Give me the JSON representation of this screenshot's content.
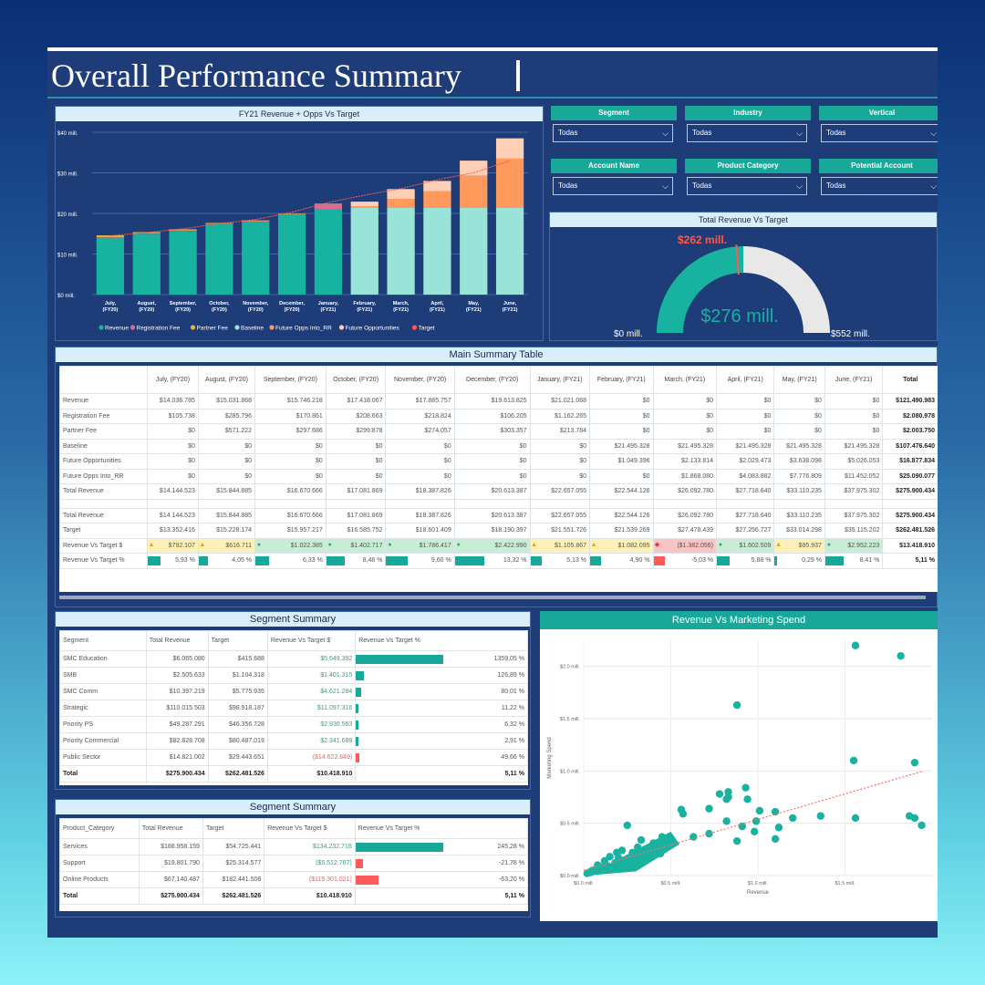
{
  "page": {
    "title": "Overall Performance Summary"
  },
  "colors": {
    "revenue": "#17b2a0",
    "baseline": "#9ae3d8",
    "future_opps_into_rr": "#ff9a5c",
    "future_opportunities": "#ffcfb5",
    "registration_fee": "#d86b9a",
    "partner_fee": "#e5b233",
    "target": "#ff5a4a",
    "accent": "#17a89a",
    "negative": "#ff5a5a"
  },
  "revenue_chart": {
    "title": "FY21 Revenue + Opps Vs Target",
    "y_ticks": [
      "$0 mill.",
      "$10 mill.",
      "$20 mill.",
      "$30 mill.",
      "$40 mill."
    ],
    "legend": [
      "Revenue",
      "Registration Fee",
      "Partner Fee",
      "Baseline",
      "Future Opps Into_RR",
      "Future Opportunities",
      "Target"
    ]
  },
  "chart_data": [
    {
      "type": "bar",
      "title": "FY21 Revenue + Opps Vs Target",
      "categories": [
        "July, (FY20)",
        "August, (FY20)",
        "September, (FY20)",
        "October, (FY20)",
        "November, (FY20)",
        "December, (FY20)",
        "January, (FY21)",
        "February, (FY21)",
        "March, (FY21)",
        "April, (FY21)",
        "May, (FY21)",
        "June, (FY21)"
      ],
      "stacked": true,
      "ylim": [
        0,
        40
      ],
      "series": [
        {
          "name": "Revenue",
          "values": [
            14.0,
            15.0,
            15.7,
            17.4,
            17.9,
            19.6,
            21.0,
            0,
            0,
            0,
            0,
            0
          ]
        },
        {
          "name": "Registration Fee",
          "values": [
            0.1,
            0.1,
            0.1,
            0.2,
            0.2,
            0.1,
            1.2,
            0,
            0,
            0,
            0,
            0
          ]
        },
        {
          "name": "Partner Fee",
          "values": [
            0.5,
            0.3,
            0.3,
            0.1,
            0.2,
            0.2,
            0.2,
            0,
            0,
            0,
            0,
            0
          ]
        },
        {
          "name": "Baseline",
          "values": [
            0,
            0,
            0,
            0,
            0,
            0,
            0,
            21.5,
            21.5,
            21.5,
            21.5,
            21.5
          ]
        },
        {
          "name": "Future Opps Into_RR",
          "values": [
            0,
            0,
            0,
            0,
            0,
            0,
            0,
            0.3,
            2.1,
            4.0,
            7.8,
            12.0
          ]
        },
        {
          "name": "Future Opportunities",
          "values": [
            0,
            0,
            0,
            0,
            0,
            0,
            0,
            1.1,
            2.4,
            2.5,
            3.7,
            5.0
          ]
        }
      ],
      "target": [
        14.5,
        15.3,
        16.2,
        17.5,
        18.5,
        20.3,
        22.7,
        24.5,
        26.1,
        28.3,
        30.0,
        33.0
      ]
    },
    {
      "type": "gauge",
      "title": "Total Revenue Vs Target",
      "value": 276,
      "target": 262,
      "min": 0,
      "max": 552,
      "value_label": "$276 mill.",
      "target_label": "$262 mill.",
      "min_label": "$0 mill.",
      "max_label": "$552 mill."
    },
    {
      "type": "scatter",
      "title": "Revenue Vs Marketing Spend",
      "xlabel": "Revenue",
      "ylabel": "Marketing Spend",
      "x_ticks": [
        "$0.0 mill.",
        "$0.5 mill.",
        "$1.0 mill.",
        "$1.5 mill."
      ],
      "y_ticks": [
        "$0.0 mill.",
        "$0.5 mill.",
        "$1.0 mill.",
        "$1.5 mill.",
        "$2.0 mill."
      ],
      "points": [
        [
          1.56,
          2.2
        ],
        [
          1.82,
          2.1
        ],
        [
          0.88,
          1.63
        ],
        [
          1.9,
          1.08
        ],
        [
          1.55,
          1.1
        ],
        [
          0.78,
          0.78
        ],
        [
          0.93,
          0.84
        ],
        [
          0.83,
          0.8
        ],
        [
          0.83,
          0.75
        ],
        [
          0.82,
          0.73
        ],
        [
          0.94,
          0.73
        ],
        [
          0.72,
          0.64
        ],
        [
          1.01,
          0.62
        ],
        [
          1.1,
          0.61
        ],
        [
          0.56,
          0.63
        ],
        [
          0.57,
          0.59
        ],
        [
          1.56,
          0.55
        ],
        [
          1.36,
          0.57
        ],
        [
          1.87,
          0.57
        ],
        [
          1.9,
          0.55
        ],
        [
          1.94,
          0.48
        ],
        [
          0.82,
          0.52
        ],
        [
          0.99,
          0.52
        ],
        [
          0.91,
          0.47
        ],
        [
          1.2,
          0.55
        ],
        [
          1.12,
          0.46
        ],
        [
          0.98,
          0.42
        ],
        [
          1.1,
          0.35
        ],
        [
          0.88,
          0.33
        ],
        [
          0.72,
          0.4
        ],
        [
          0.63,
          0.37
        ],
        [
          0.45,
          0.37
        ],
        [
          0.4,
          0.31
        ],
        [
          0.33,
          0.34
        ],
        [
          0.44,
          0.21
        ],
        [
          0.25,
          0.48
        ],
        [
          0.31,
          0.27
        ],
        [
          0.28,
          0.22
        ],
        [
          0.35,
          0.19
        ],
        [
          0.22,
          0.24
        ],
        [
          0.19,
          0.22
        ],
        [
          0.15,
          0.18
        ],
        [
          0.12,
          0.14
        ],
        [
          0.08,
          0.1
        ],
        [
          0.05,
          0.05
        ],
        [
          0.1,
          0.08
        ],
        [
          0.18,
          0.12
        ],
        [
          0.14,
          0.09
        ],
        [
          0.04,
          0.03
        ],
        [
          0.07,
          0.06
        ],
        [
          0.02,
          0.02
        ],
        [
          0.25,
          0.15
        ],
        [
          0.2,
          0.17
        ]
      ],
      "trend": [
        [
          0.0,
          0.05
        ],
        [
          1.95,
          1.0
        ]
      ]
    }
  ],
  "filters": [
    {
      "label": "Segment",
      "value": "Todas"
    },
    {
      "label": "Industry",
      "value": "Todas"
    },
    {
      "label": "Vertical",
      "value": "Todas"
    },
    {
      "label": "Account Name",
      "value": "Todas"
    },
    {
      "label": "Product Category",
      "value": "Todas"
    },
    {
      "label": "Potential Account",
      "value": "Todas"
    }
  ],
  "gauge": {
    "title": "Total Revenue Vs Target",
    "value_label": "$276 mill.",
    "target_label": "$262 mill.",
    "min_label": "$0 mill.",
    "max_label": "$552 mill."
  },
  "main_table": {
    "title": "Main Summary Table",
    "columns": [
      "",
      "July, (FY20)",
      "August, (FY20)",
      "September, (FY20)",
      "October, (FY20)",
      "November, (FY20)",
      "December, (FY20)",
      "January, (FY21)",
      "February, (FY21)",
      "March, (FY21)",
      "April, (FY21)",
      "May, (FY21)",
      "June, (FY21)",
      "Total"
    ],
    "rows": [
      [
        "Revenue",
        "$14.036.785",
        "$15.031.868",
        "$15.746.218",
        "$17.418.067",
        "$17.885.757",
        "$19.613.825",
        "$21.021.068",
        "$0",
        "$0",
        "$0",
        "$0",
        "$0",
        "$121.490.983"
      ],
      [
        "Registration Fee",
        "$105.738",
        "$285.796",
        "$170.861",
        "$208.663",
        "$218.824",
        "$106.205",
        "$1.162.265",
        "$0",
        "$0",
        "$0",
        "$0",
        "$0",
        "$2.080.978"
      ],
      [
        "Partner Fee",
        "$0",
        "$571.222",
        "$297.686",
        "$299.878",
        "$274.057",
        "$303.357",
        "$213.784",
        "$0",
        "$0",
        "$0",
        "$0",
        "$0",
        "$2.003.750"
      ],
      [
        "Baseline",
        "$0",
        "$0",
        "$0",
        "$0",
        "$0",
        "$0",
        "$0",
        "$21.495.328",
        "$21.495.328",
        "$21.495.328",
        "$21.495.328",
        "$21.495.328",
        "$107.476.640"
      ],
      [
        "Future Opportunities",
        "$0",
        "$0",
        "$0",
        "$0",
        "$0",
        "$0",
        "$0",
        "$1.049.396",
        "$2.133.814",
        "$2.029.473",
        "$3.638.098",
        "$5.026.053",
        "$16.877.834"
      ],
      [
        "Future Opps Into_RR",
        "$0",
        "$0",
        "$0",
        "$0",
        "$0",
        "$0",
        "$0",
        "$0",
        "$1.868.080",
        "$4.083.882",
        "$7.776.809",
        "$11.452.052",
        "$25.090.077"
      ],
      [
        "Total Revenue",
        "$14.144.523",
        "$15.844.885",
        "$16.670.666",
        "$17.081.869",
        "$18.387.826",
        "$20.613.387",
        "$22.657.055",
        "$22.544.126",
        "$26.092.780",
        "$27.718.640",
        "$33.110.235",
        "$37.975.302",
        "$275.900.434"
      ],
      null,
      [
        "Total Revenue",
        "$14.144.523",
        "$15.844.885",
        "$16.670.666",
        "$17.081.869",
        "$18.387.826",
        "$20.613.387",
        "$22.657.055",
        "$22.544.126",
        "$26.092.780",
        "$27.718.640",
        "$33.110.235",
        "$37.975.302",
        "$275.900.434"
      ],
      [
        "Target",
        "$13.352.416",
        "$15.228.174",
        "$15.957.217",
        "$16.585.752",
        "$18.601.409",
        "$18.190.397",
        "$21.551.726",
        "$21.539.269",
        "$27.478.439",
        "$27.256.727",
        "$33.014.298",
        "$35.115.202",
        "$262.481.526"
      ]
    ],
    "vt_label": "Revenue Vs Target $",
    "vt_values": [
      "$792.107",
      "$616.711",
      "$1.022.385",
      "$1.402.717",
      "$1.786.417",
      "$2.422.990",
      "$1.105.867",
      "$1.082.095",
      "($1.382.056)",
      "$1.602.509",
      "$95.937",
      "$2.952.223"
    ],
    "vt_status": [
      "warn",
      "warn",
      "ok",
      "ok",
      "ok",
      "ok",
      "warn",
      "warn",
      "bad",
      "ok",
      "warn",
      "ok"
    ],
    "vt_total": "$13.418.910",
    "pct_label": "Revenue Vs Target %",
    "pct_values": [
      "5,93 %",
      "4,05 %",
      "6,33 %",
      "8,46 %",
      "9,60 %",
      "13,32 %",
      "5,13 %",
      "4,90 %",
      "-5,03 %",
      "5,88 %",
      "0,29 %",
      "8,41 %"
    ],
    "pct_num": [
      5.93,
      4.05,
      6.33,
      8.46,
      9.6,
      13.32,
      5.13,
      4.9,
      -5.03,
      5.88,
      0.29,
      8.41
    ],
    "pct_total": "5,11 %"
  },
  "segment_table": {
    "title": "Segment Summary",
    "columns": [
      "Segment",
      "Total Revenue",
      "Target",
      "Revenue Vs Target $",
      "Revenue Vs Target %"
    ],
    "rows": [
      [
        "SMC Education",
        "$6.065.080",
        "$415.688",
        "$5.649.392",
        "1359,05 %"
      ],
      [
        "SMB",
        "$2.505.633",
        "$1.104.318",
        "$1.401.315",
        "126,89 %"
      ],
      [
        "SMC Comm",
        "$10.397.219",
        "$5.775.935",
        "$4.621.284",
        "80,01 %"
      ],
      [
        "Strategic",
        "$110.015.503",
        "$98.918.187",
        "$11.097.316",
        "11,22 %"
      ],
      [
        "Priority PS",
        "$49.287.291",
        "$46.356.728",
        "$2.930.563",
        "6,32 %"
      ],
      [
        "Priority Commercial",
        "$82.828.708",
        "$80.487.019",
        "$2.341.689",
        "2,91 %"
      ],
      [
        "Public Sector",
        "$14.821.002",
        "$29.443.651",
        "($14.622.649)",
        "49,66 %"
      ]
    ],
    "pct_num": [
      1359.05,
      126.89,
      80.01,
      11.22,
      6.32,
      2.91,
      -49.66
    ],
    "neg_rows": [
      false,
      false,
      false,
      false,
      false,
      false,
      true
    ],
    "total": [
      "Total",
      "$275.900.434",
      "$262.481.526",
      "$10.418.910",
      "5,11 %"
    ]
  },
  "product_table": {
    "title": "Segment Summary",
    "columns": [
      "Product_Category",
      "Total Revenue",
      "Target",
      "Revenue Vs Target $",
      "Revenue Vs Target %"
    ],
    "rows": [
      [
        "Services",
        "$188.958.159",
        "$54.725.441",
        "$134.232.718",
        "245,28 %"
      ],
      [
        "Support",
        "$19.801.790",
        "$25.314.577",
        "($5.512.787)",
        "-21,78 %"
      ],
      [
        "Online Products",
        "$67.140.487",
        "$182.441.508",
        "($115.301.021)",
        "-63,20 %"
      ]
    ],
    "pct_num": [
      245.28,
      -21.78,
      -63.2
    ],
    "neg_rows": [
      false,
      false,
      true
    ],
    "total": [
      "Total",
      "$275.900.434",
      "$262.481.526",
      "$10.418.910",
      "5,11 %"
    ]
  },
  "scatter": {
    "title": "Revenue Vs Marketing Spend",
    "xlabel": "Revenue",
    "ylabel": "Marketing Spend"
  }
}
